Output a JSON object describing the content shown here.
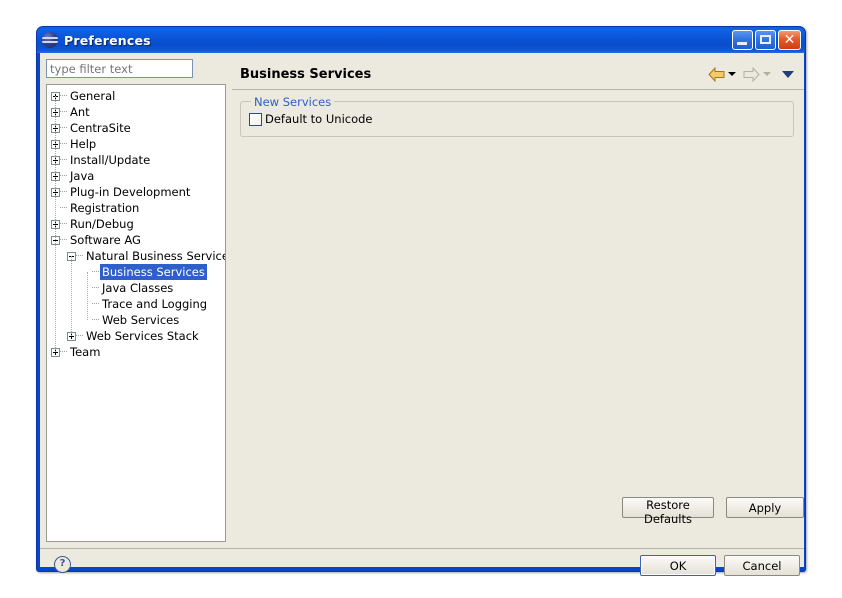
{
  "window": {
    "title": "Preferences",
    "icon": "eclipse-logo-icon",
    "controls": {
      "minimize": "minimize-button",
      "maximize": "maximize-button",
      "close_glyph": "✕"
    }
  },
  "filter": {
    "value": "",
    "placeholder": "type filter text"
  },
  "tree": {
    "items": [
      {
        "label": "General",
        "indent": 0,
        "state": "collapsed"
      },
      {
        "label": "Ant",
        "indent": 0,
        "state": "collapsed"
      },
      {
        "label": "CentraSite",
        "indent": 0,
        "state": "collapsed"
      },
      {
        "label": "Help",
        "indent": 0,
        "state": "collapsed"
      },
      {
        "label": "Install/Update",
        "indent": 0,
        "state": "collapsed"
      },
      {
        "label": "Java",
        "indent": 0,
        "state": "collapsed"
      },
      {
        "label": "Plug-in Development",
        "indent": 0,
        "state": "collapsed"
      },
      {
        "label": "Registration",
        "indent": 0,
        "state": "leaf"
      },
      {
        "label": "Run/Debug",
        "indent": 0,
        "state": "collapsed"
      },
      {
        "label": "Software AG",
        "indent": 0,
        "state": "expanded"
      },
      {
        "label": "Natural Business Services",
        "indent": 1,
        "state": "expanded"
      },
      {
        "label": "Business Services",
        "indent": 2,
        "state": "leaf",
        "selected": true
      },
      {
        "label": "Java Classes",
        "indent": 2,
        "state": "leaf"
      },
      {
        "label": "Trace and Logging",
        "indent": 2,
        "state": "leaf"
      },
      {
        "label": "Web Services",
        "indent": 2,
        "state": "leaf"
      },
      {
        "label": "Web Services Stack",
        "indent": 1,
        "state": "collapsed"
      },
      {
        "label": "Team",
        "indent": 0,
        "state": "collapsed"
      }
    ]
  },
  "content": {
    "title": "Business Services",
    "nav": {
      "back": "back-arrow-icon",
      "forward": "forward-arrow-icon",
      "menu": "dropdown-chevron-icon"
    },
    "group": {
      "title": "New Services",
      "checkbox": {
        "label": "Default to Unicode",
        "checked": false
      }
    },
    "buttons": {
      "restore_defaults": "Restore Defaults",
      "apply": "Apply"
    }
  },
  "footer": {
    "help_glyph": "?",
    "ok": "OK",
    "cancel": "Cancel"
  },
  "colors": {
    "title_bar_blue": "#0b55d8",
    "dialog_background": "#ece9df",
    "selection_blue": "#2f5fc8",
    "group_label_blue": "#2f5fc8",
    "close_red": "#e55a28"
  }
}
